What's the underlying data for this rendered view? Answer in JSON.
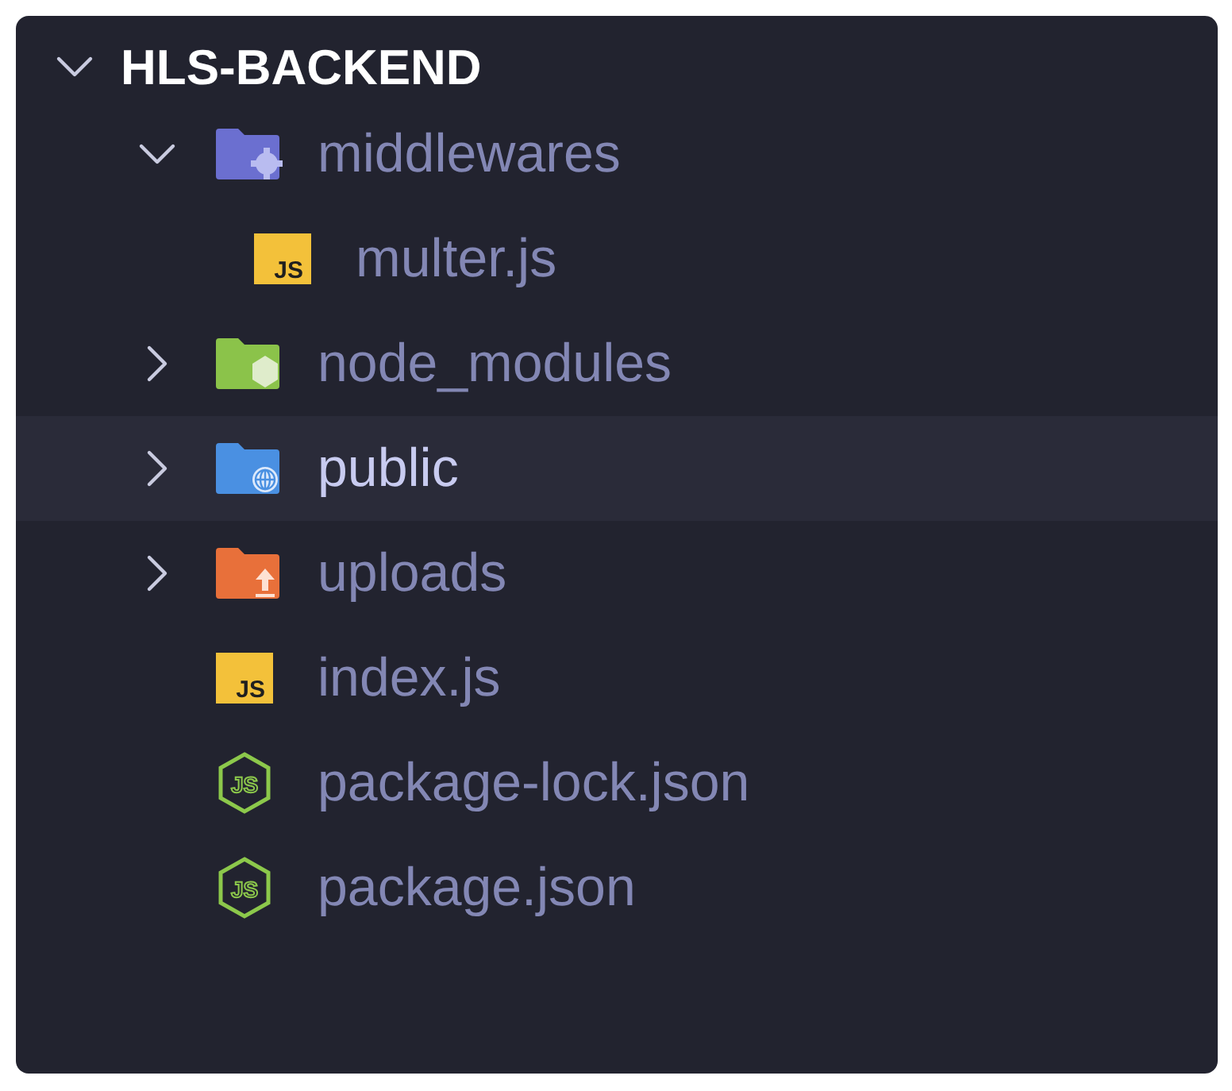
{
  "root": {
    "name": "HLS-BACKEND",
    "expanded": true,
    "children": [
      {
        "kind": "gearfolder",
        "color": "#6b6fd0",
        "name": "middlewares",
        "expanded": true,
        "selected": false,
        "children": [
          {
            "kind": "js",
            "icon_text": "JS",
            "name": "multer.js",
            "selected": false
          }
        ]
      },
      {
        "kind": "nodefolder",
        "color": "#8bc34a",
        "name": "node_modules",
        "expanded": false,
        "selected": false
      },
      {
        "kind": "webfolder",
        "color": "#4a90e2",
        "name": "public",
        "expanded": false,
        "selected": true
      },
      {
        "kind": "uploadfolder",
        "color": "#e8703a",
        "name": "uploads",
        "expanded": false,
        "selected": false
      },
      {
        "kind": "js",
        "icon_text": "JS",
        "name": "index.js",
        "selected": false
      },
      {
        "kind": "node",
        "icon_text": "JS",
        "name": "package-lock.json",
        "selected": false
      },
      {
        "kind": "node",
        "icon_text": "JS",
        "name": "package.json",
        "selected": false
      }
    ]
  }
}
